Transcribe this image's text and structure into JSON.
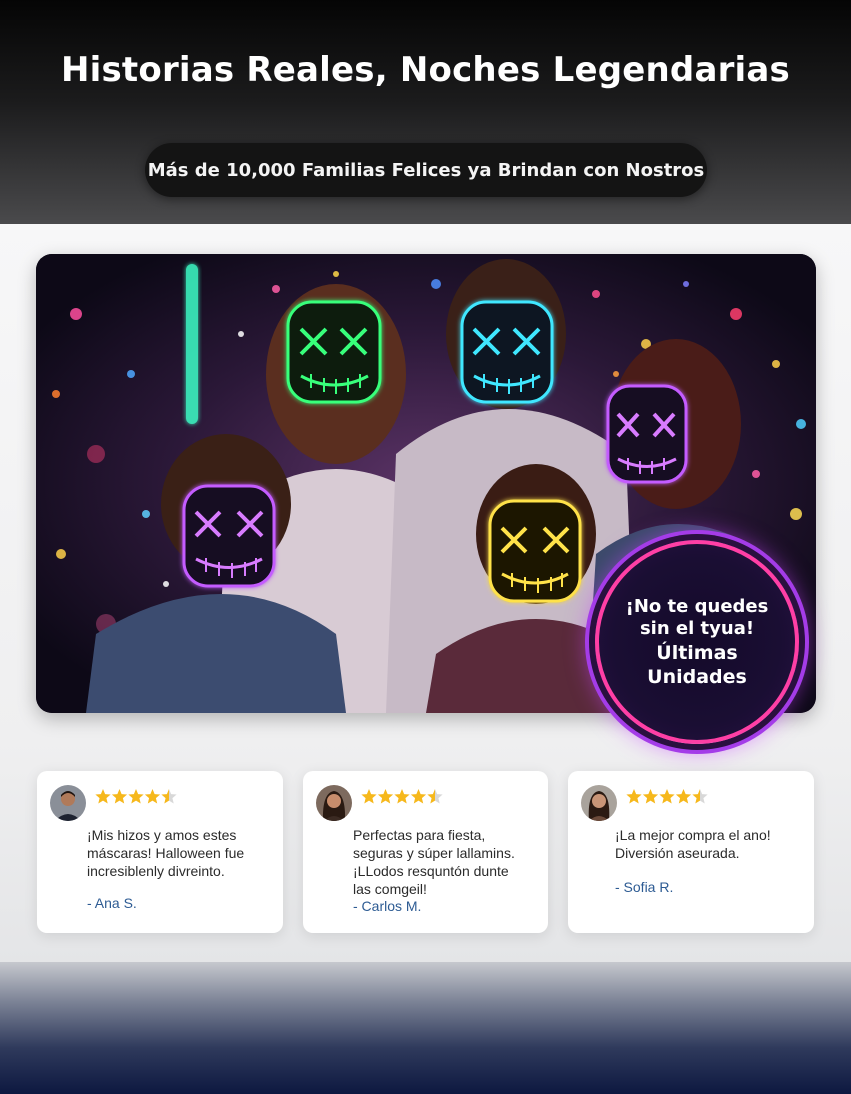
{
  "header": {
    "headline": "Historias Reales, Noches Legendarias",
    "pill_text": "Más de 10,000 Familias Felices ya Brindan con Nostros"
  },
  "hero": {
    "badge_line1": "¡No te quedes",
    "badge_line2": "sin el tyua!",
    "badge_line3": "Últimas",
    "badge_line4": "Unidades",
    "mask_colors": [
      "#39ff7a",
      "#3fe7ff",
      "#c45bff",
      "#ffe24a",
      "#d87bff"
    ]
  },
  "reviews": [
    {
      "rating": 4.5,
      "text": [
        "¡Mis hizos y amos estes",
        "máscaras! Halloween fue",
        "incresiblenly divreinto."
      ],
      "author": "- Ana S."
    },
    {
      "rating": 4.5,
      "text": [
        "Perfectas para fiesta,",
        "seguras y súper lallamins.",
        "¡LLodos resquntón dunte",
        "las comgeil!"
      ],
      "author": "- Carlos M."
    },
    {
      "rating": 4.5,
      "text": [
        "¡La mejor compra el ano!",
        "Diversión aseurada."
      ],
      "author": "- Sofia R."
    }
  ],
  "colors": {
    "star": "#f6b81c",
    "author": "#2d5b93",
    "badge_ring": "#ff3fa5"
  }
}
